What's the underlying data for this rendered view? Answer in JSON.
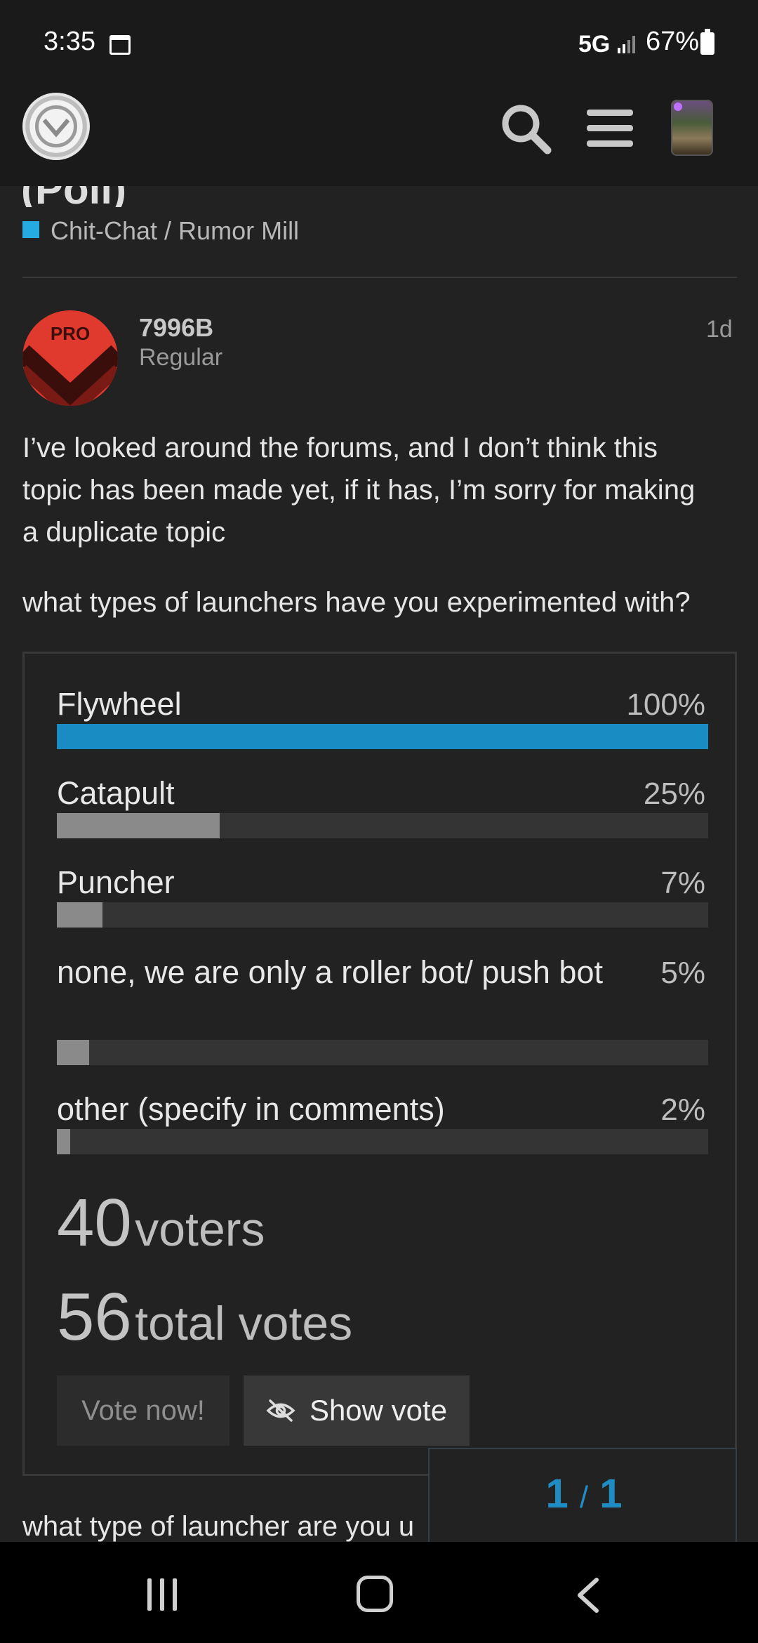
{
  "status_bar": {
    "time": "3:35",
    "network": "5G",
    "battery_pct": "67%"
  },
  "topic": {
    "title_partial": "(Poll)",
    "category": "Chit-Chat / Rumor Mill",
    "category_color": "#25aae1"
  },
  "post": {
    "avatar_text": "PRO",
    "username": "7996B",
    "user_title": "Regular",
    "date": "1d",
    "paragraph1_line1": "I’ve looked around the forums, and I don’t think this",
    "paragraph1_line2": "topic has been made yet, if it has, I’m sorry for making",
    "paragraph1_line3": "a duplicate topic",
    "paragraph2": "what types of launchers have you experimented with?",
    "paragraph3_partial": "what type of launcher are you u"
  },
  "poll": {
    "options": [
      {
        "label": "Flywheel",
        "percent_text": "100%",
        "percent": 100
      },
      {
        "label": "Catapult",
        "percent_text": "25%",
        "percent": 25
      },
      {
        "label": "Puncher",
        "percent_text": "7%",
        "percent": 7
      },
      {
        "label": "none, we are only a roller bot/ push bot",
        "percent_text": "5%",
        "percent": 5
      },
      {
        "label": "other (specify in comments)",
        "percent_text": "2%",
        "percent": 2
      }
    ],
    "voters_count": "40",
    "voters_label": "voters",
    "total_votes_count": "56",
    "total_votes_label": "total votes",
    "vote_button": "Vote now!",
    "show_vote_button": "Show vote",
    "accent_color": "#1a8cc4"
  },
  "timeline": {
    "current": "1",
    "separator": "/",
    "total": "1"
  },
  "icons": {
    "header": [
      "site-logo",
      "search-icon",
      "menu-icon",
      "user-avatar"
    ],
    "nav": [
      "recent-apps-icon",
      "home-icon",
      "back-icon"
    ]
  }
}
